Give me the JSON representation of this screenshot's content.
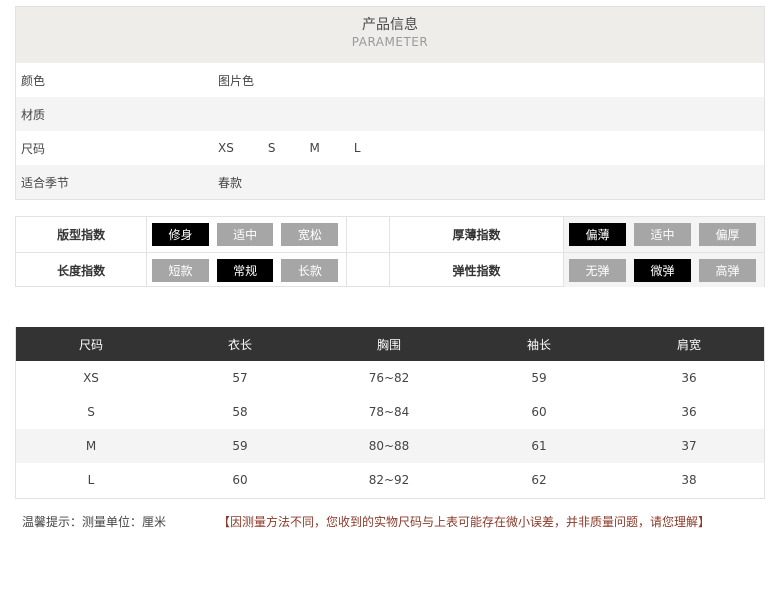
{
  "info": {
    "title": "产品信息",
    "subtitle": "PARAMETER",
    "rows": [
      {
        "label": "颜色",
        "values": [
          "图片色"
        ]
      },
      {
        "label": "材质",
        "values": []
      },
      {
        "label": "尺码",
        "values": [
          "XS",
          "S",
          "M",
          "L"
        ]
      },
      {
        "label": "适合季节",
        "values": [
          "春款"
        ]
      }
    ]
  },
  "index": {
    "rows": [
      {
        "left": {
          "label": "版型指数",
          "options": [
            {
              "text": "修身",
              "selected": true
            },
            {
              "text": "适中",
              "selected": false
            },
            {
              "text": "宽松",
              "selected": false
            }
          ]
        },
        "right": {
          "label": "厚薄指数",
          "options": [
            {
              "text": "偏薄",
              "selected": true
            },
            {
              "text": "适中",
              "selected": false
            },
            {
              "text": "偏厚",
              "selected": false
            }
          ]
        }
      },
      {
        "left": {
          "label": "长度指数",
          "options": [
            {
              "text": "短款",
              "selected": false
            },
            {
              "text": "常规",
              "selected": true
            },
            {
              "text": "长款",
              "selected": false
            }
          ]
        },
        "right": {
          "label": "弹性指数",
          "options": [
            {
              "text": "无弹",
              "selected": false
            },
            {
              "text": "微弹",
              "selected": true
            },
            {
              "text": "高弹",
              "selected": false
            }
          ]
        }
      }
    ],
    "colors": {
      "selected": "#000000",
      "unselected": "#a6a6a6"
    }
  },
  "size_table": {
    "headers": [
      "尺码",
      "衣长",
      "胸围",
      "袖长",
      "肩宽"
    ],
    "rows": [
      [
        "XS",
        "57",
        "76~82",
        "59",
        "36"
      ],
      [
        "S",
        "58",
        "78~84",
        "60",
        "36"
      ],
      [
        "M",
        "59",
        "80~88",
        "61",
        "37"
      ],
      [
        "L",
        "60",
        "82~92",
        "62",
        "38"
      ]
    ],
    "header_bg": "#333333"
  },
  "note": {
    "left": "温馨提示：测量单位：厘米",
    "right": "【因测量方法不同，您收到的实物尺码与上表可能存在微小误差，并非质量问题，请您理解】",
    "accent": "#8a3a2a"
  }
}
